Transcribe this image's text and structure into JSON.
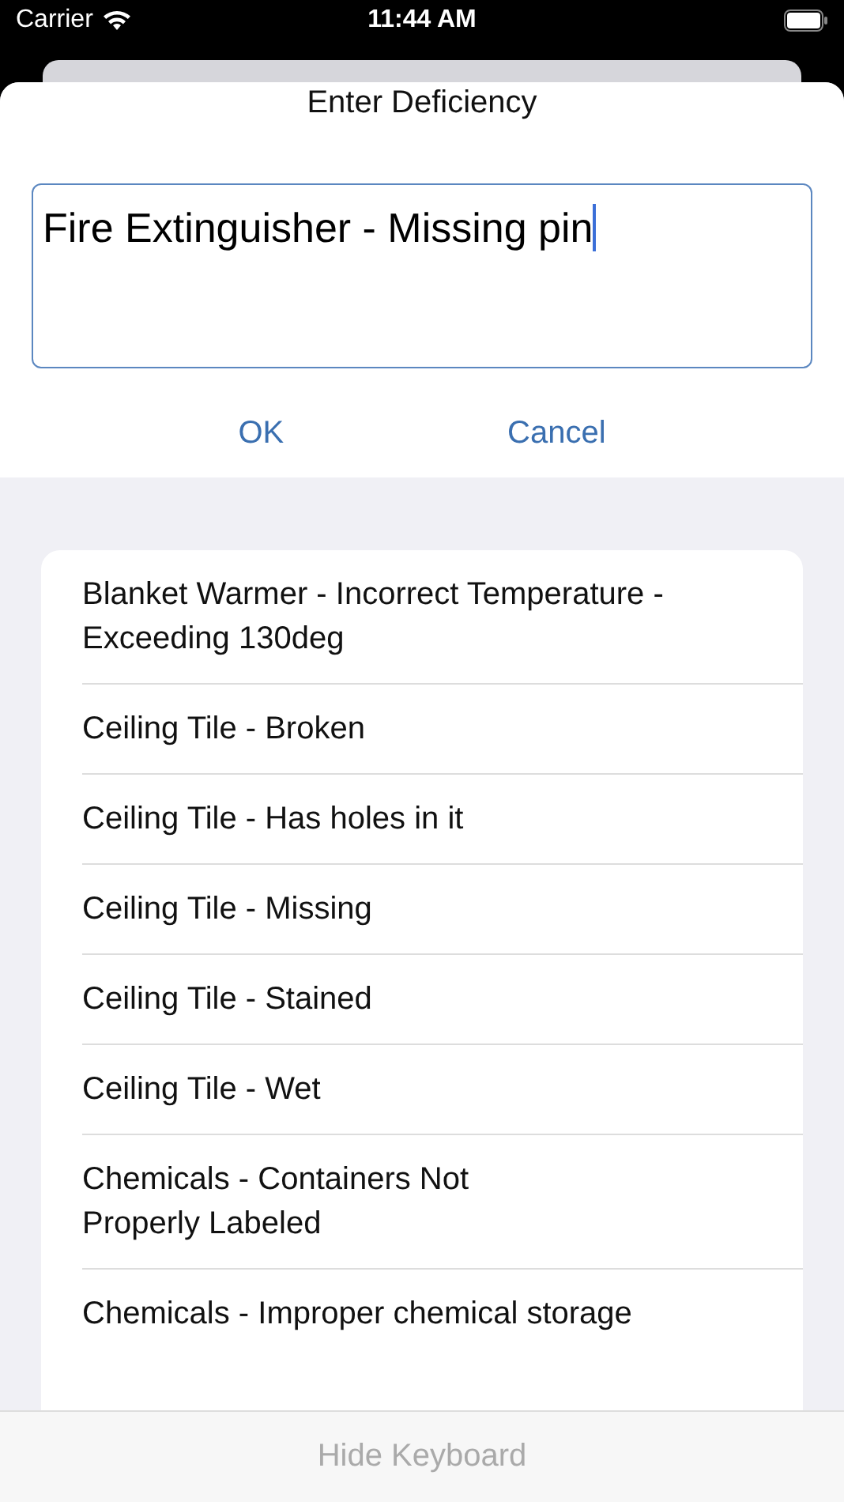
{
  "status_bar": {
    "carrier": "Carrier",
    "time": "11:44 AM"
  },
  "dialog": {
    "title": "Enter Deficiency",
    "value": "Fire Extinguisher - Missing pin",
    "buttons": [
      "OK",
      "Cancel"
    ]
  },
  "list": [
    {
      "label": "Blanket Warmer - Incorrect Temperature - Exceeding 130deg"
    },
    {
      "label": "Ceiling Tile - Broken"
    },
    {
      "label": "Ceiling Tile - Has holes in it"
    },
    {
      "label": "Ceiling Tile - Missing"
    },
    {
      "label": "Ceiling Tile - Stained"
    },
    {
      "label": "Ceiling Tile - Wet"
    },
    {
      "label": "Chemicals - Containers Not\nProperly Labeled"
    },
    {
      "label": "Chemicals - Improper chemical storage"
    }
  ],
  "bottom_bar": {
    "label": "Hide Keyboard",
    "disabled": true
  }
}
